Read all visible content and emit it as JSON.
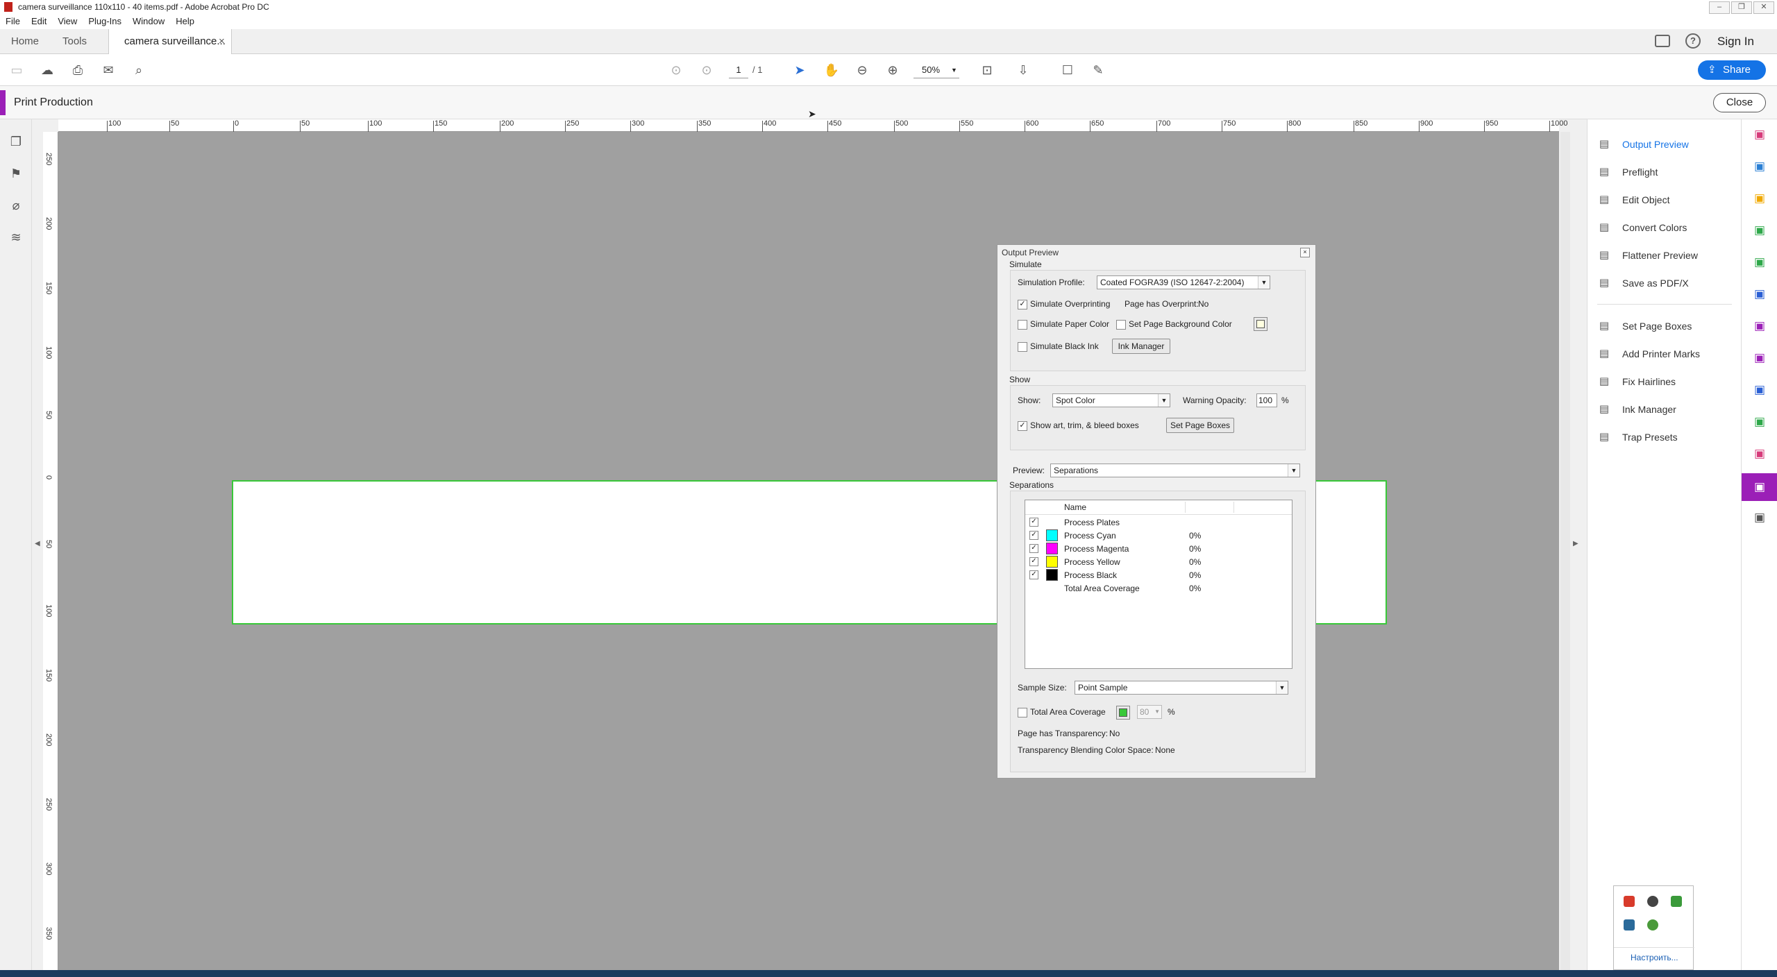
{
  "window": {
    "title": "camera surveillance 110x110 - 40 items.pdf - Adobe Acrobat Pro DC",
    "controls": [
      "–",
      "❐",
      "✕"
    ]
  },
  "menu": [
    "File",
    "Edit",
    "View",
    "Plug-Ins",
    "Window",
    "Help"
  ],
  "tabs": {
    "home": "Home",
    "tools": "Tools",
    "document": "camera surveillance...",
    "close_glyph": "×"
  },
  "header_right": {
    "sign_in": "Sign In",
    "share": "Share"
  },
  "toolbar": {
    "page_current": "1",
    "page_total": "/ 1",
    "zoom": "50%"
  },
  "print_production": {
    "title": "Print Production",
    "close": "Close"
  },
  "ruler_h": [
    "100",
    "50",
    "0",
    "50",
    "100",
    "150",
    "200",
    "250",
    "300",
    "350",
    "400",
    "450",
    "500",
    "550",
    "600",
    "650",
    "700",
    "750",
    "800",
    "850",
    "900",
    "950",
    "1000"
  ],
  "ruler_v": [
    "250",
    "200",
    "150",
    "100",
    "50",
    "0",
    "50",
    "100",
    "150",
    "200",
    "250",
    "300",
    "350"
  ],
  "right_panel": {
    "group1": [
      {
        "label": "Output Preview",
        "icon": "output-preview-icon",
        "active": true
      },
      {
        "label": "Preflight",
        "icon": "preflight-icon"
      },
      {
        "label": "Edit Object",
        "icon": "edit-object-icon"
      },
      {
        "label": "Convert Colors",
        "icon": "convert-colors-icon"
      },
      {
        "label": "Flattener Preview",
        "icon": "flattener-preview-icon"
      },
      {
        "label": "Save as PDF/X",
        "icon": "save-pdfx-icon"
      }
    ],
    "group2": [
      {
        "label": "Set Page Boxes",
        "icon": "set-page-boxes-icon"
      },
      {
        "label": "Add Printer Marks",
        "icon": "printer-marks-icon"
      },
      {
        "label": "Fix Hairlines",
        "icon": "fix-hairlines-icon"
      },
      {
        "label": "Ink Manager",
        "icon": "ink-manager-icon"
      },
      {
        "label": "Trap Presets",
        "icon": "trap-presets-icon"
      }
    ]
  },
  "right_rail_colors": [
    "#d63b7a",
    "#2a7fd4",
    "#f0a800",
    "#2ea84a",
    "#2ea84a",
    "#2a5fd4",
    "#9b1fb7",
    "#9b1fb7",
    "#2a5fd4",
    "#2ea84a",
    "#d63b7a",
    "#ffffff",
    "#555555"
  ],
  "output_preview": {
    "title": "Output Preview",
    "simulate": {
      "group_label": "Simulate",
      "profile_label": "Simulation Profile:",
      "profile_value": "Coated FOGRA39 (ISO 12647-2:2004)",
      "overprinting_label": "Simulate Overprinting",
      "overprinting_checked": true,
      "page_overprint_label": "Page has Overprint:",
      "page_overprint_value": "No",
      "paper_color_label": "Simulate Paper Color",
      "page_bg_label": "Set Page Background Color",
      "black_ink_label": "Simulate Black Ink",
      "ink_manager_button": "Ink Manager"
    },
    "show": {
      "group_label": "Show",
      "show_label": "Show:",
      "show_value": "Spot Color",
      "warning_label": "Warning Opacity:",
      "warning_value": "100",
      "warning_unit": "%",
      "boxes_label": "Show art, trim, & bleed boxes",
      "boxes_checked": true,
      "set_boxes_button": "Set Page Boxes"
    },
    "preview": {
      "label": "Preview:",
      "value": "Separations"
    },
    "separations": {
      "group_label": "Separations",
      "col_name": "Name",
      "rows": [
        {
          "name": "Process Plates",
          "value": "",
          "color": ""
        },
        {
          "name": "Process Cyan",
          "value": "0%",
          "color": "#00ffff"
        },
        {
          "name": "Process Magenta",
          "value": "0%",
          "color": "#ff00ff"
        },
        {
          "name": "Process Yellow",
          "value": "0%",
          "color": "#ffff00"
        },
        {
          "name": "Process Black",
          "value": "0%",
          "color": "#000000"
        },
        {
          "name": "Total Area Coverage",
          "value": "0%",
          "color": ""
        }
      ]
    },
    "sample": {
      "label": "Sample Size:",
      "value": "Point Sample"
    },
    "tac": {
      "label": "Total Area Coverage",
      "value": "80",
      "unit": "%"
    },
    "transparency_label": "Page has Transparency:",
    "transparency_value": "No",
    "blending_label": "Transparency Blending Color Space:",
    "blending_value": "None"
  },
  "tray_popup": {
    "customize": "Настроить..."
  }
}
